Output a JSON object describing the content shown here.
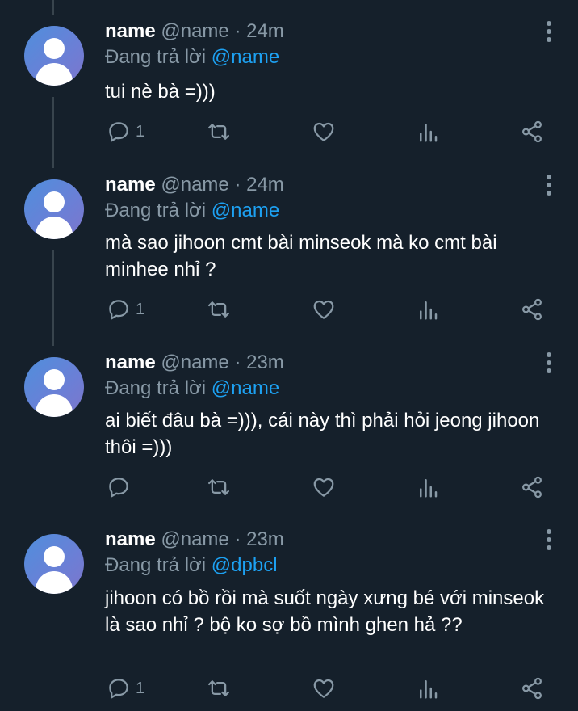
{
  "tweets": [
    {
      "name": "name",
      "handle": "@name",
      "time": "· 24m",
      "reply_prefix": "Đang trả lời",
      "reply_to": "@name",
      "text": "tui nè bà =)))",
      "reply_count": "1"
    },
    {
      "name": "name",
      "handle": "@name",
      "time": "· 24m",
      "reply_prefix": "Đang trả lời",
      "reply_to": "@name",
      "text": "mà sao jihoon cmt bài minseok mà ko cmt bài minhee nhỉ ?",
      "reply_count": "1"
    },
    {
      "name": "name",
      "handle": "@name",
      "time": "· 23m",
      "reply_prefix": "Đang trả lời",
      "reply_to": "@name",
      "text": "ai biết đâu bà =))), cái này thì phải hỏi jeong jihoon thôi =)))",
      "reply_count": ""
    },
    {
      "name": "name",
      "handle": "@name",
      "time": "· 23m",
      "reply_prefix": "Đang trả lời",
      "reply_to": "@dpbcl",
      "text": "jihoon có bồ rồi mà suốt ngày xưng bé với minseok là sao nhỉ ? bộ ko sợ bồ mình ghen hả ??",
      "reply_count": "1"
    }
  ],
  "icons": [
    "reply-icon",
    "retweet-icon",
    "like-icon",
    "analytics-icon",
    "share-icon",
    "more-icon"
  ],
  "colors": {
    "background": "#15202b",
    "secondary_text": "#8899a6",
    "link": "#1da1f2",
    "line": "#38444d"
  }
}
